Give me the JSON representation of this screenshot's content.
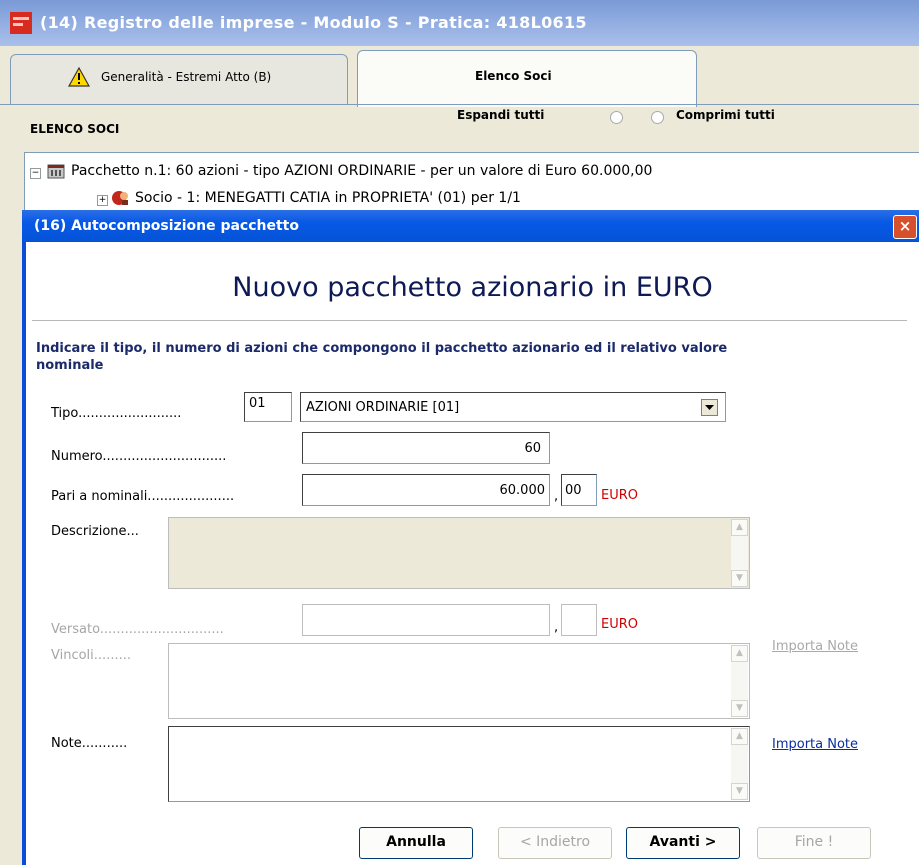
{
  "window": {
    "title": "(14) Registro delle imprese - Modulo S - Pratica: 418L0615"
  },
  "tabs": [
    {
      "label": "Generalità - Estremi Atto (B)",
      "has_warning": true
    },
    {
      "label": "Elenco Soci",
      "active": true
    }
  ],
  "elenco": {
    "title": "ELENCO SOCI",
    "expand_label": "Espandi tutti",
    "collapse_label": "Comprimi tutti"
  },
  "tree": {
    "rows": [
      {
        "text": "Pacchetto n.1: 60 azioni - tipo AZIONI ORDINARIE - per un valore di Euro 60.000,00",
        "toggle": "−"
      },
      {
        "text": "Socio - 1: MENEGATTI CATIA in PROPRIETA' (01) per 1/1",
        "toggle": "+"
      }
    ]
  },
  "dialog": {
    "title": "(16) Autocomposizione pacchetto",
    "close": "×",
    "heading": "Nuovo pacchetto azionario in EURO",
    "instruction": "Indicare il tipo, il numero di azioni che compongono il pacchetto azionario ed il relativo valore nominale",
    "tipo": {
      "label": "Tipo.........................",
      "code": "01",
      "value": "AZIONI ORDINARIE [01]"
    },
    "numero": {
      "label": "Numero..............................",
      "value": "60"
    },
    "pari": {
      "label": "Pari a nominali.....................",
      "integer": "60.000",
      "separator": ",",
      "decimals": "00",
      "currency": "EURO"
    },
    "descrizione": {
      "label": "Descrizione..."
    },
    "versato": {
      "label": "Versato..............................",
      "separator": ",",
      "currency": "EURO"
    },
    "vincoli": {
      "label": "Vincoli.........",
      "import": "Importa Note"
    },
    "note": {
      "label": "Note...........",
      "import": "Importa Note"
    },
    "buttons": {
      "annulla": "Annulla",
      "indietro": "< Indietro",
      "avanti": "Avanti >",
      "fine": "Fine !"
    }
  },
  "colors": {
    "titlebar": "#97b1e3",
    "dialog_titlebar": "#0453d7",
    "heading": "#0d1a55",
    "euro": "#d10000",
    "link_enabled": "#0b2e9e"
  }
}
